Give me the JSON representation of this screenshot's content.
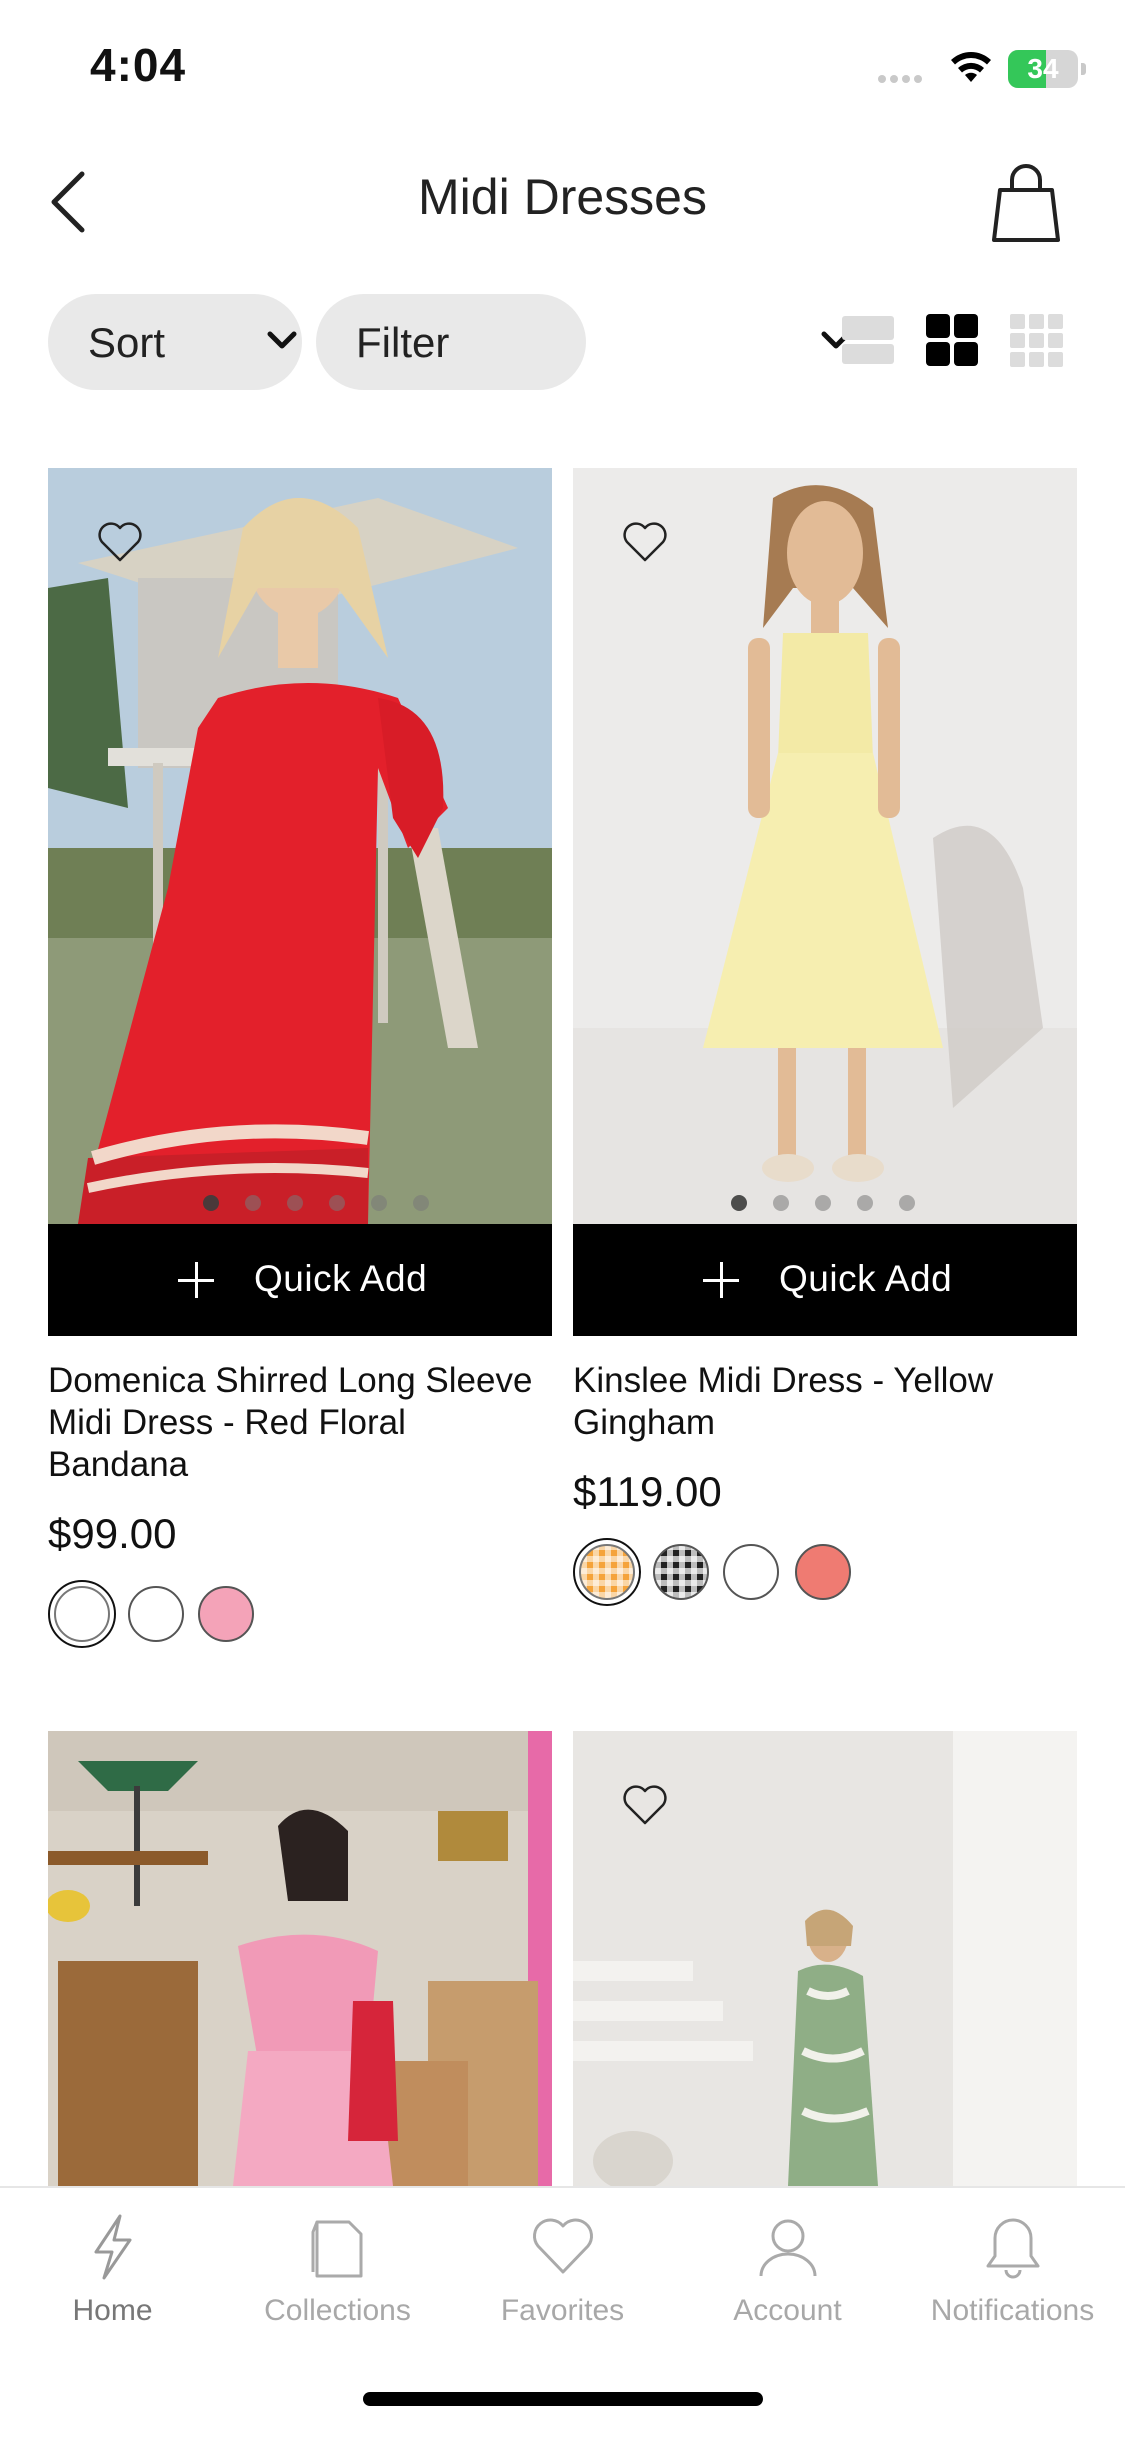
{
  "status_bar": {
    "time": "4:04",
    "battery": "34"
  },
  "header": {
    "title": "Midi Dresses",
    "back_icon": "chevron-left-icon",
    "bag_icon": "shopping-bag-icon"
  },
  "toolbar": {
    "sort_label": "Sort",
    "filter_label": "Filter",
    "view_options": [
      "single-view-icon",
      "grid-2-view-icon",
      "grid-3-view-icon"
    ],
    "active_view": "grid-2-view-icon"
  },
  "quick_add_label": "Quick Add",
  "products": [
    {
      "name": "Domenica Shirred Long Sleeve Midi Dress - Red Floral Bandana",
      "price": "$99.00",
      "image_dots": 6,
      "active_dot": 0,
      "swatches": [
        "#ffffff",
        "#ffffff",
        "#f4a3b8"
      ],
      "selected_swatch": 0
    },
    {
      "name": "Kinslee Midi Dress - Yellow Gingham",
      "price": "$119.00",
      "image_dots": 5,
      "active_dot": 0,
      "swatches": [
        "#f5a33a",
        "#222222",
        "#ffffff",
        "#ef7b72"
      ],
      "selected_swatch": 0
    },
    {
      "name": "",
      "price": ""
    },
    {
      "name": "",
      "price": ""
    }
  ],
  "tabs": [
    {
      "label": "Home",
      "icon": "lightning-icon",
      "active": true
    },
    {
      "label": "Collections",
      "icon": "collections-icon",
      "active": false
    },
    {
      "label": "Favorites",
      "icon": "heart-icon",
      "active": false
    },
    {
      "label": "Account",
      "icon": "person-icon",
      "active": false
    },
    {
      "label": "Notifications",
      "icon": "bell-icon",
      "active": false
    }
  ],
  "colors": {
    "accent": "#000000",
    "pill_bg": "#e9e9e9",
    "inactive_text": "#a8a8a8"
  }
}
